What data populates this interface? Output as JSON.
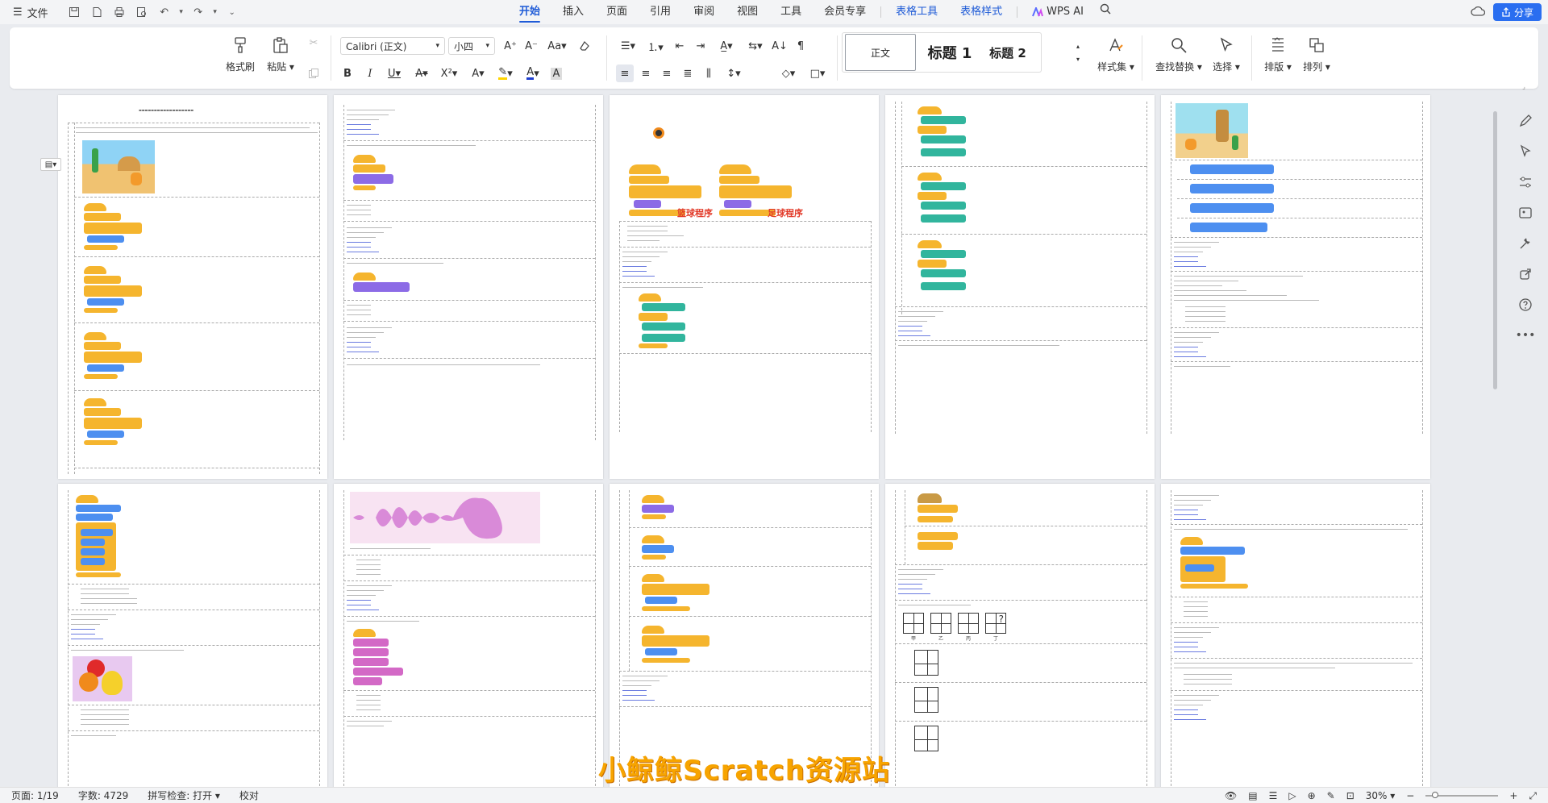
{
  "menubar": {
    "file_label": "文件",
    "tabs": [
      "开始",
      "插入",
      "页面",
      "引用",
      "审阅",
      "视图",
      "工具",
      "会员专享"
    ],
    "context_tabs": [
      "表格工具",
      "表格样式"
    ],
    "ai_label": "WPS AI",
    "share_label": "分享"
  },
  "ribbon": {
    "format_painter": "格式刷",
    "paste": "粘贴",
    "font_name": "Calibri (正文)",
    "font_size": "小四",
    "styles": {
      "normal": "正文",
      "h1": "标题 1",
      "h2": "标题 2"
    },
    "style_set": "样式集",
    "find_replace": "查找替换",
    "select": "选择",
    "layout": "排版",
    "arrange": "排列"
  },
  "doc": {
    "caption_basketball": "篮球程序",
    "caption_football": "足球程序",
    "labels_jiayibing": [
      "甲",
      "乙",
      "丙",
      "丁"
    ]
  },
  "watermark": "小鲸鲸Scratch资源站",
  "statusbar": {
    "page": "页面: 1/19",
    "words": "字数: 4729",
    "spellcheck": "拼写检查: 打开",
    "proof": "校对",
    "zoom": "30%"
  },
  "colors": {
    "accent": "#1f5bd7",
    "share": "#2a6ef0",
    "watermark": "#f7a400"
  }
}
